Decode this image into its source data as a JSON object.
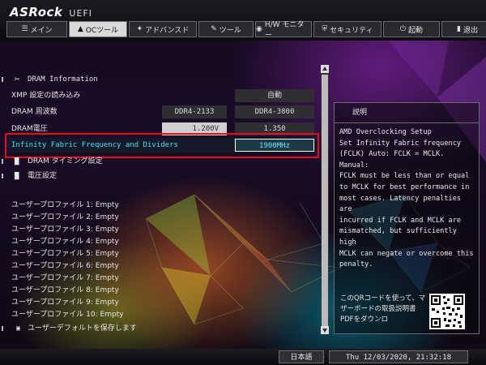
{
  "brand": {
    "name": "ASRock",
    "sub": "UEFI"
  },
  "tabs": [
    {
      "label": "メイン",
      "icon": "list-icon",
      "glyph": "☰"
    },
    {
      "label": "OCツール",
      "icon": "rocket-icon",
      "glyph": "▲"
    },
    {
      "label": "アドバンスド",
      "icon": "star-icon",
      "glyph": "✦"
    },
    {
      "label": "ツール",
      "icon": "wrench-icon",
      "glyph": "✎"
    },
    {
      "label": "H/W モニター",
      "icon": "gauge-icon",
      "glyph": "◉"
    },
    {
      "label": "セキュリティ",
      "icon": "shield-icon",
      "glyph": "⛨"
    },
    {
      "label": "起動",
      "icon": "power-icon",
      "glyph": "⏻"
    },
    {
      "label": "退出",
      "icon": "exit-icon",
      "glyph": "▮"
    }
  ],
  "active_tab": 1,
  "section_title": "DRAM Information",
  "rows": {
    "xmp": {
      "label": "XMP 設定の読み込み",
      "value": "自動"
    },
    "freq": {
      "label": "DRAM 周波数",
      "value": "DDR4-2133",
      "value2": "DDR4-3800"
    },
    "volt": {
      "label": "DRAM電圧",
      "value": "1.200V",
      "value2": "1.350"
    },
    "fclk": {
      "label": "Infinity Fabric Frequency and Dividers",
      "value": "1900MHz"
    },
    "timing": {
      "label": "DRAM タイミング設定"
    },
    "voltage": {
      "label": "電圧設定"
    }
  },
  "profiles": [
    "ユーザープロファイル 1: Empty",
    "ユーザープロファイル 2: Empty",
    "ユーザープロファイル 3: Empty",
    "ユーザープロファイル 4: Empty",
    "ユーザープロファイル 5: Empty",
    "ユーザープロファイル 6: Empty",
    "ユーザープロファイル 7: Empty",
    "ユーザープロファイル 8: Empty",
    "ユーザープロファイル 9: Empty",
    "ユーザープロファイル 10: Empty"
  ],
  "save_default": "ユーザーデフォルトを保存します",
  "help": {
    "title": "説明",
    "text": "AMD Overclocking Setup\nSet Infinity Fabric frequency\n(FCLK) Auto: FCLK = MCLK. Manual:\nFCLK must be less than or equal\nto MCLK for best performance in\nmost cases. Latency penalties are\nincurred if FCLK and MCLK are\nmismatched, but sufficiently high\nMCLK can negate or overcome this\npenalty."
  },
  "qr_text": "このQRコードを使って、マザーボードの取扱説明書PDFをダウンロ",
  "language": "日本語",
  "datetime": "Thu 12/03/2020, 21:32:18",
  "colors": {
    "highlight_text": "#3fe0ff",
    "highlight_box": "#e01020"
  }
}
